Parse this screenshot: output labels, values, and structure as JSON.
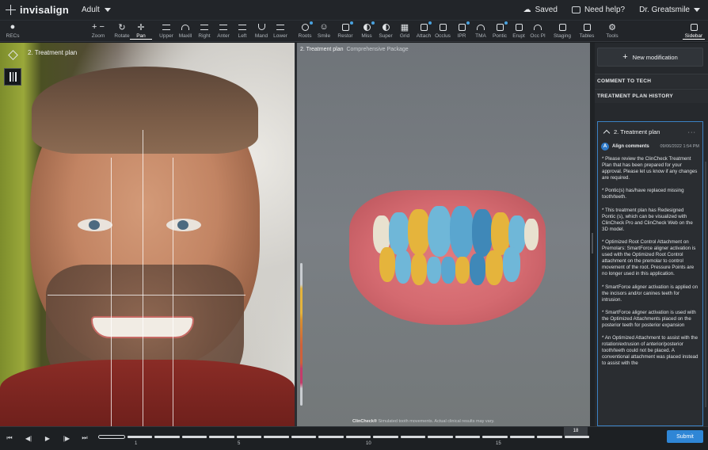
{
  "app": {
    "brand": "invisalign",
    "profile": "Adult"
  },
  "topbar": {
    "saved": "Saved",
    "help": "Need help?",
    "user": "Dr. Greatsmile"
  },
  "toolbar": {
    "items": [
      {
        "label": "RECs",
        "icon": "person-icon"
      },
      {
        "label": "Zoom",
        "icon": "zoom-icon"
      },
      {
        "label": "Rotate",
        "icon": "rotate-icon"
      },
      {
        "label": "Pan",
        "icon": "pan-icon"
      },
      {
        "label": "Upper",
        "icon": "upper-arch-icon"
      },
      {
        "label": "Maxill",
        "icon": "maxillary-icon"
      },
      {
        "label": "Right",
        "icon": "right-view-icon"
      },
      {
        "label": "Anter",
        "icon": "anterior-view-icon"
      },
      {
        "label": "Left",
        "icon": "left-view-icon"
      },
      {
        "label": "Mand",
        "icon": "mandibular-icon"
      },
      {
        "label": "Lower",
        "icon": "lower-arch-icon"
      },
      {
        "label": "Roots",
        "icon": "roots-icon"
      },
      {
        "label": "Smile",
        "icon": "smile-icon"
      },
      {
        "label": "Restor",
        "icon": "restoration-icon"
      },
      {
        "label": "Miss",
        "icon": "missing-teeth-icon"
      },
      {
        "label": "Super",
        "icon": "superimpose-icon"
      },
      {
        "label": "Grid",
        "icon": "grid-icon"
      },
      {
        "label": "Attach",
        "icon": "attachment-icon"
      },
      {
        "label": "Occlus",
        "icon": "occlusion-icon"
      },
      {
        "label": "IPR",
        "icon": "ipr-icon"
      },
      {
        "label": "TMA",
        "icon": "tma-icon"
      },
      {
        "label": "Pontic",
        "icon": "pontic-icon"
      },
      {
        "label": "Erupt",
        "icon": "erupt-icon"
      },
      {
        "label": "Occ Pl",
        "icon": "occlusal-plane-icon"
      },
      {
        "label": "Staging",
        "icon": "staging-icon"
      },
      {
        "label": "Tables",
        "icon": "tables-icon"
      },
      {
        "label": "Tools",
        "icon": "tools-icon"
      },
      {
        "label": "Sidebar",
        "icon": "sidebar-icon"
      }
    ]
  },
  "photo": {
    "label": "2. Treatment plan"
  },
  "model": {
    "title": "2. Treatment plan",
    "subtitle": "Comprehensive Package",
    "footer_brand": "ClinCheck®",
    "footer_text": "Simulated tooth movements. Actual clinical results may vary."
  },
  "sidebar": {
    "new_modification": "New modification",
    "comment_to_tech": "COMMENT TO TECH",
    "history": "TREATMENT PLAN HISTORY",
    "card_title": "2. Treatment plan",
    "card_menu": "···",
    "comment": {
      "avatar": "A",
      "author": "Align comments",
      "date": "09/06/2022 1:54 PM",
      "paragraphs": [
        "* Please review the ClinCheck Treatment Plan that has been prepared for your approval. Please let us know if any changes are required.",
        "* Pontic(s) has/have replaced missing tooth/teeth.",
        "* This treatment plan has Redesigned Pontic (s), which can be visualized with ClinCheck Pro and ClinCheck Web on the 3D model.",
        "* Optimized Root Control Attachment on Premolars: SmartForce aligner activation is used with the Optimized Root Control attachment on the premolar to control movement of the root. Pressure Points are no longer used in this application.",
        "* SmartForce aligner activation is applied on the incisors and/or canines teeth for intrusion.",
        "* SmartForce aligner activation is used with the Optimized Attachments placed on the posterior teeth for posterior expansion",
        "* An Optimized Attachment to assist with the rotation/extrusion of anterior/posterior tooth/teeth could not be placed. A conventional attachment was placed instead to assist with the"
      ]
    }
  },
  "timeline": {
    "stage_labels": [
      "1",
      "5",
      "10",
      "15"
    ],
    "current_stage": "18",
    "submit": "Submit"
  },
  "colors": {
    "accent": "#2f86d6",
    "movement_yellow": "#e5b43c",
    "tooth_blue": "#6fb7d8",
    "gum": "#d46a70"
  }
}
